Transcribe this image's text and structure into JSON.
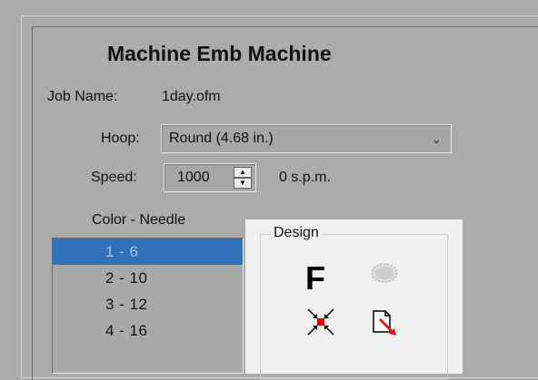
{
  "title": "Machine Emb Machine",
  "job": {
    "label": "Job Name:",
    "value": "1day.ofm"
  },
  "hoop": {
    "label": "Hoop:",
    "value": "Round (4.68 in.)"
  },
  "speed": {
    "label": "Speed:",
    "value": "1000",
    "rate": "0 s.p.m."
  },
  "color_needle": {
    "label": "Color - Needle",
    "items": [
      "1 - 6",
      "2 - 10",
      "3 - 12",
      "4 - 16"
    ],
    "selected_index": 0
  },
  "design": {
    "label": "Design",
    "font_button": "F"
  },
  "icons": {
    "hoop_dropdown": "chevron-down-icon",
    "speed_up": "spin-up-icon",
    "speed_down": "spin-down-icon",
    "oval": "oval-icon",
    "center": "center-arrows-icon",
    "edit": "edit-document-icon"
  },
  "colors": {
    "selection": "#3271b8",
    "center_dot": "#e00000",
    "edit_arrow": "#d81b1b"
  }
}
